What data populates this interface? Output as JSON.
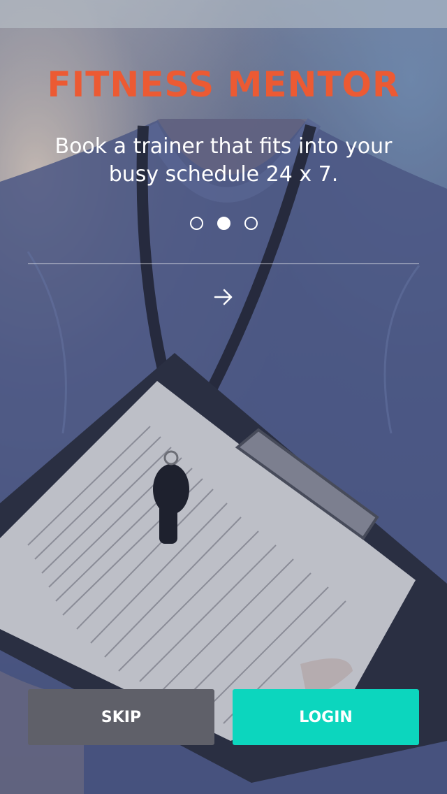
{
  "app": {
    "title": "FITNESS MENTOR",
    "tagline": "Book a trainer that fits into your busy schedule 24 x 7."
  },
  "pager": {
    "count": 3,
    "active_index": 1
  },
  "icons": {
    "next": "arrow-right-icon"
  },
  "buttons": {
    "skip_label": "SKIP",
    "login_label": "LOGIN"
  },
  "colors": {
    "title": "#ec5a33",
    "login": "#0cd6be",
    "skip": "#5f6069"
  }
}
